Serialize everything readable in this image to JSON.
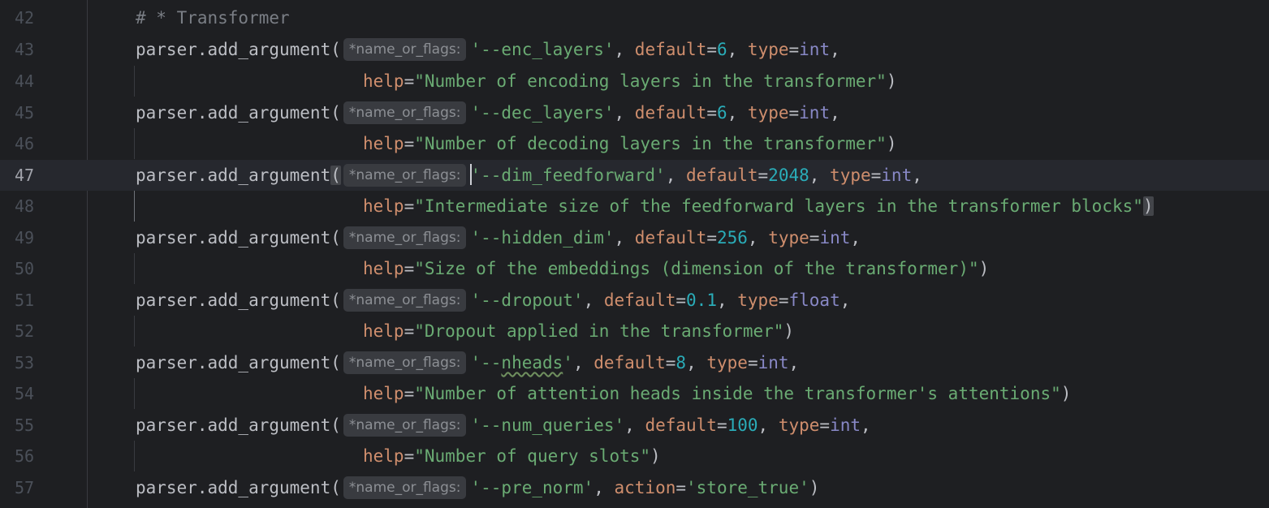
{
  "editor": {
    "hint_label": "*name_or_flags:",
    "lines": [
      {
        "num": "42",
        "comment": "# * Transformer"
      },
      {
        "num": "43",
        "call": "parser.add_argument(",
        "flag": "'--enc_layers'",
        "k1": "default",
        "v1": "6",
        "k2": "type",
        "v2": "int",
        "tail": ","
      },
      {
        "num": "44",
        "help_kw": "help",
        "help_str": "\"Number of encoding layers in the transformer\"",
        "close": ")"
      },
      {
        "num": "45",
        "call": "parser.add_argument(",
        "flag": "'--dec_layers'",
        "k1": "default",
        "v1": "6",
        "k2": "type",
        "v2": "int",
        "tail": ","
      },
      {
        "num": "46",
        "help_kw": "help",
        "help_str": "\"Number of decoding layers in the transformer\"",
        "close": ")"
      },
      {
        "num": "47",
        "call": "parser.add_argument",
        "open": "(",
        "flag": "'--dim_feedforward'",
        "k1": "default",
        "v1": "2048",
        "k2": "type",
        "v2": "int",
        "tail": ","
      },
      {
        "num": "48",
        "help_kw": "help",
        "help_str": "\"Intermediate size of the feedforward layers in the transformer blocks\"",
        "close": ")"
      },
      {
        "num": "49",
        "call": "parser.add_argument(",
        "flag": "'--hidden_dim'",
        "k1": "default",
        "v1": "256",
        "k2": "type",
        "v2": "int",
        "tail": ","
      },
      {
        "num": "50",
        "help_kw": "help",
        "help_str": "\"Size of the embeddings (dimension of the transformer)\"",
        "close": ")"
      },
      {
        "num": "51",
        "call": "parser.add_argument(",
        "flag": "'--dropout'",
        "k1": "default",
        "v1": "0.1",
        "k2": "type",
        "v2": "float",
        "tail": ","
      },
      {
        "num": "52",
        "help_kw": "help",
        "help_str": "\"Dropout applied in the transformer\"",
        "close": ")"
      },
      {
        "num": "53",
        "call": "parser.add_argument(",
        "flag_a": "'--",
        "flag_b": "nheads",
        "flag_c": "'",
        "k1": "default",
        "v1": "8",
        "k2": "type",
        "v2": "int",
        "tail": ","
      },
      {
        "num": "54",
        "help_kw": "help",
        "help_str": "\"Number of attention heads inside the transformer's attentions\"",
        "close": ")"
      },
      {
        "num": "55",
        "call": "parser.add_argument(",
        "flag": "'--num_queries'",
        "k1": "default",
        "v1": "100",
        "k2": "type",
        "v2": "int",
        "tail": ","
      },
      {
        "num": "56",
        "help_kw": "help",
        "help_str": "\"Number of query slots\"",
        "close": ")"
      },
      {
        "num": "57",
        "call": "parser.add_argument(",
        "flag": "'--pre_norm'",
        "k1": "action",
        "v1": "'store_true'",
        "close": ")"
      }
    ]
  }
}
